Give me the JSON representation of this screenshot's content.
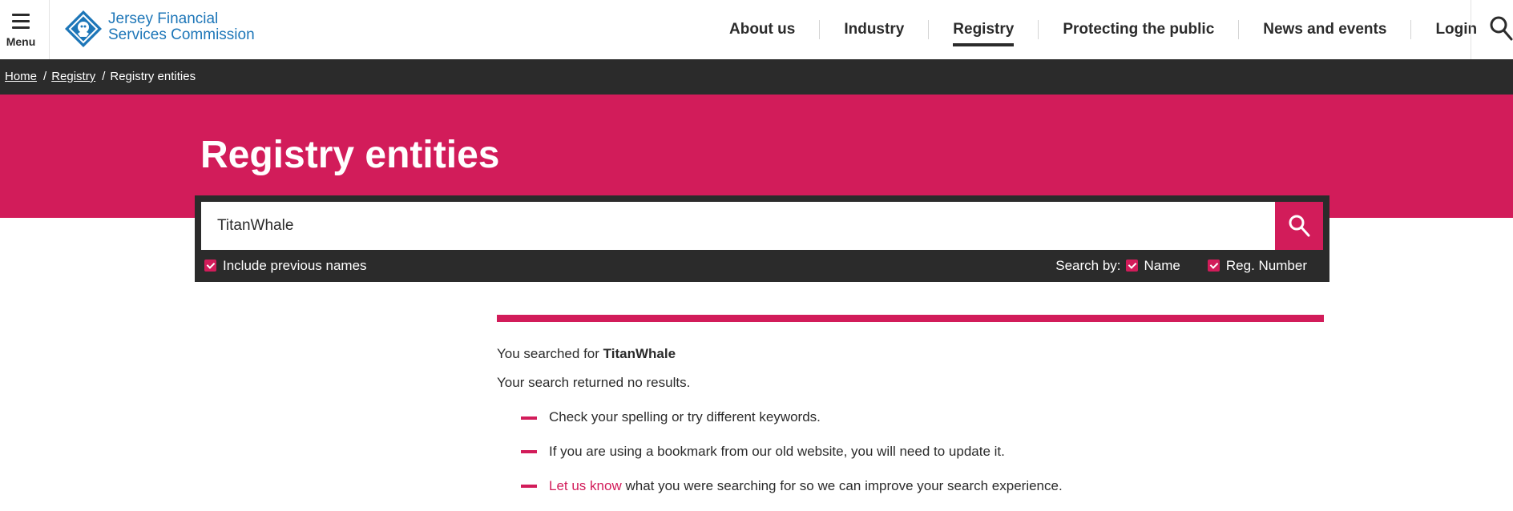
{
  "header": {
    "menu_label": "Menu",
    "logo_line1": "Jersey Financial",
    "logo_line2": "Services Commission",
    "nav": [
      "About us",
      "Industry",
      "Registry",
      "Protecting the public",
      "News and events",
      "Login"
    ],
    "active_nav": "Registry"
  },
  "breadcrumb": {
    "home": "Home",
    "registry": "Registry",
    "current": "Registry entities"
  },
  "hero": {
    "title": "Registry entities"
  },
  "search": {
    "value": "TitanWhale",
    "include_previous_label": "Include previous names",
    "include_previous_checked": true,
    "search_by_label": "Search by:",
    "name_label": "Name",
    "name_checked": true,
    "regnum_label": "Reg. Number",
    "regnum_checked": true
  },
  "results": {
    "searched_prefix": "You searched for",
    "query": "TitanWhale",
    "no_results": "Your search returned no results.",
    "tip1": "Check your spelling or try different keywords.",
    "tip2": "If you are using a bookmark from our old website, you will need to update it.",
    "tip3_link": "Let us know",
    "tip3_rest": "what you were searching for so we can improve your search experience."
  },
  "colors": {
    "accent": "#d21c5a",
    "dark": "#2b2b2b",
    "logo_blue": "#1d76b8"
  },
  "icons": [
    "menu-icon",
    "logo-icon",
    "search-icon",
    "checkbox-checked-icon"
  ]
}
